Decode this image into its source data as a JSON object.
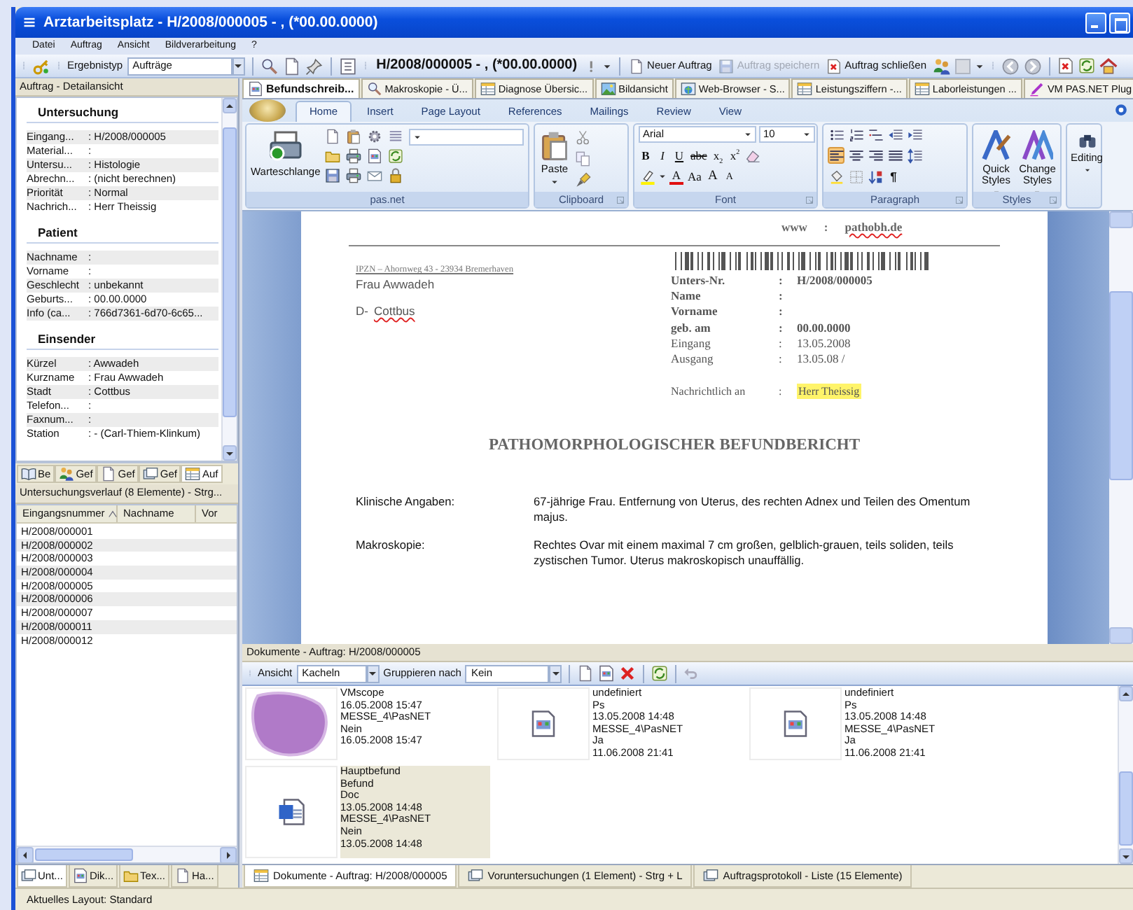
{
  "window": {
    "title": "Arztarbeitsplatz - H/2008/000005 - , (*00.00.0000)"
  },
  "menu": [
    "Datei",
    "Auftrag",
    "Ansicht",
    "Bildverarbeitung",
    "?"
  ],
  "toolbar": {
    "result_type_label": "Ergebnistyp",
    "result_type_value": "Aufträge",
    "case_title": "H/2008/000005 - , (*00.00.0000)",
    "buttons": [
      {
        "label": "Neuer Auftrag",
        "disabled": false
      },
      {
        "label": "Auftrag speichern",
        "disabled": true
      },
      {
        "label": "Auftrag schließen",
        "disabled": false
      }
    ]
  },
  "detail_panel": {
    "title": "Auftrag - Detailansicht",
    "sections": [
      {
        "title": "Untersuchung",
        "fields": [
          {
            "label": "Eingang...",
            "value": ": H/2008/000005"
          },
          {
            "label": "Material...",
            "value": ":"
          },
          {
            "label": "Untersu...",
            "value": ": Histologie"
          },
          {
            "label": "Abrechn...",
            "value": ": (nicht berechnen)"
          },
          {
            "label": "Priorität",
            "value": ": Normal"
          },
          {
            "label": "Nachrich...",
            "value": ": Herr Theissig"
          }
        ]
      },
      {
        "title": "Patient",
        "fields": [
          {
            "label": "Nachname",
            "value": ":"
          },
          {
            "label": "Vorname",
            "value": ":"
          },
          {
            "label": "Geschlecht",
            "value": ": unbekannt"
          },
          {
            "label": "Geburts...",
            "value": ": 00.00.0000"
          },
          {
            "label": "Info (ca...",
            "value": ": 766d7361-6d70-6c65..."
          }
        ]
      },
      {
        "title": "Einsender",
        "fields": [
          {
            "label": "Kürzel",
            "value": ": Awwadeh"
          },
          {
            "label": "Kurzname",
            "value": ": Frau Awwadeh"
          },
          {
            "label": "Stadt",
            "value": ": Cottbus"
          },
          {
            "label": "Telefon...",
            "value": ":"
          },
          {
            "label": "Faxnum...",
            "value": ":"
          },
          {
            "label": "Station",
            "value": ": - (Carl-Thiem-Klinkum)"
          }
        ]
      }
    ],
    "nav_tabs": [
      {
        "label": "Be",
        "selected": false
      },
      {
        "label": "Gef",
        "selected": false
      },
      {
        "label": "Gef",
        "selected": false
      },
      {
        "label": "Gef",
        "selected": false
      },
      {
        "label": "Auf",
        "selected": true
      }
    ]
  },
  "history": {
    "title": "Untersuchungsverlauf (8 Elemente) - Strg...",
    "columns": [
      {
        "label": "Eingangsnummer",
        "sorted": true
      },
      {
        "label": "Nachname",
        "sorted": false
      },
      {
        "label": "Vor",
        "sorted": false
      }
    ],
    "rows": [
      "H/2008/000001",
      "H/2008/000002",
      "H/2008/000003",
      "H/2008/000004",
      "H/2008/000005",
      "H/2008/000006",
      "H/2008/000007",
      "H/2008/000011",
      "H/2008/000012"
    ]
  },
  "left_tabs": [
    {
      "label": "Unt...",
      "selected": true
    },
    {
      "label": "Dik...",
      "selected": false
    },
    {
      "label": "Tex...",
      "selected": false
    },
    {
      "label": "Ha...",
      "selected": false
    }
  ],
  "doc_tabs": [
    {
      "label": "Befundschreib...",
      "selected": true
    },
    {
      "label": "Makroskopie - Ü...",
      "selected": false
    },
    {
      "label": "Diagnose Übersic...",
      "selected": false
    },
    {
      "label": "Bildansicht",
      "selected": false
    },
    {
      "label": "Web-Browser - S...",
      "selected": false
    },
    {
      "label": "Leistungsziffern -...",
      "selected": false
    },
    {
      "label": "Laborleistungen ...",
      "selected": false
    },
    {
      "label": "VM PAS.NET Plug",
      "selected": false
    }
  ],
  "ribbon": {
    "tabs": [
      {
        "label": "Home",
        "selected": true
      },
      {
        "label": "Insert",
        "selected": false
      },
      {
        "label": "Page Layout",
        "selected": false
      },
      {
        "label": "References",
        "selected": false
      },
      {
        "label": "Mailings",
        "selected": false
      },
      {
        "label": "Review",
        "selected": false
      },
      {
        "label": "View",
        "selected": false
      }
    ],
    "groups": [
      {
        "kind": "pasnet",
        "label": "pas.net",
        "button": "Warteschlange"
      },
      {
        "kind": "clipboard",
        "label": "Clipboard",
        "button": "Paste"
      },
      {
        "kind": "font",
        "label": "Font",
        "font": "Arial",
        "size": "10",
        "buttons": [
          {
            "label": "B",
            "kind": "bold"
          },
          {
            "label": "I",
            "kind": "italic"
          },
          {
            "label": "U",
            "kind": "underline"
          },
          {
            "label": "abc",
            "kind": "strike"
          },
          {
            "label": "x$_{2}$",
            "kind": "plain"
          },
          {
            "label": "x$^{2}$",
            "kind": "plain"
          }
        ],
        "buttons2": [
          {
            "label": "A",
            "kind": "color"
          },
          {
            "label": "Aa",
            "kind": "plain"
          },
          {
            "label": "A",
            "kind": "grow"
          },
          {
            "label": "A",
            "kind": "shrink"
          }
        ]
      },
      {
        "kind": "paragraph",
        "label": "Paragraph",
        "align_buttons": [
          {
            "kind": "left",
            "selected": true
          },
          {
            "kind": "center",
            "selected": false
          },
          {
            "kind": "right",
            "selected": false
          },
          {
            "kind": "justify",
            "selected": false
          }
        ],
        "marks_button": "¶"
      },
      {
        "kind": "styles",
        "label": "Styles",
        "buttons": [
          "Quick Styles",
          "Change Styles"
        ]
      },
      {
        "kind": "editing",
        "button": "Editing"
      }
    ]
  },
  "document": {
    "website": {
      "label": "www",
      "sep": ":",
      "value": "pathobh.de",
      "misspelled": true
    },
    "sender": "IPZN – Ahornweg 43 - 23934 Bremerhaven",
    "recipient": "Frau Awwadeh",
    "country": "D-",
    "city": {
      "text": "Cottbus",
      "misspelled": true
    },
    "info": [
      {
        "label": "Unters-Nr.",
        "sep": ":",
        "value": "H/2008/000005",
        "bold": true
      },
      {
        "label": "Name",
        "sep": ":",
        "bold": true
      },
      {
        "label": "Vorname",
        "sep": ":",
        "bold": true
      },
      {
        "label": "geb. am",
        "sep": ":",
        "value": "00.00.0000",
        "bold": true
      },
      {
        "label": "Eingang",
        "sep": ":",
        "value": "13.05.2008",
        "bold": false
      },
      {
        "label": "Ausgang",
        "sep": ":",
        "value": "13.05.08  /",
        "bold": false
      }
    ],
    "cc": {
      "label": "Nachrichtlich an",
      "sep": ":",
      "value": "Herr Theissig",
      "highlighted": true
    },
    "title": "PATHOMORPHOLOGISCHER BEFUNDBERICHT",
    "sections": [
      {
        "label": "Klinische Angaben:",
        "text": "67-jährige Frau. Entfernung von Uterus, des rechten Adnex und Teilen des Omentum majus."
      },
      {
        "label": "Makroskopie:",
        "text": "Rechtes Ovar mit einem maximal 7 cm großen, gelblich-grauen, teils soliden, teils zystischen Tumor. Uterus makroskopisch unauffällig."
      }
    ]
  },
  "documents_panel": {
    "title": "Dokumente - Auftrag: H/2008/000005",
    "view_label": "Ansicht",
    "view_value": "Kacheln",
    "group_label": "Gruppieren nach",
    "group_value": "Kein",
    "tiles": [
      {
        "kind": "slide",
        "selected": false,
        "lines": [
          "VMscope",
          "16.05.2008 15:47",
          "MESSE_4\\PasNET",
          "Nein",
          "16.05.2008 15:47"
        ]
      },
      {
        "kind": "file",
        "selected": false,
        "lines": [
          "undefiniert",
          "Ps",
          "13.05.2008 14:48",
          "MESSE_4\\PasNET",
          "Ja",
          "11.06.2008 21:41"
        ]
      },
      {
        "kind": "file",
        "selected": false,
        "lines": [
          "undefiniert",
          "Ps",
          "13.05.2008 14:48",
          "MESSE_4\\PasNET",
          "Ja",
          "11.06.2008 21:41"
        ]
      },
      {
        "kind": "word",
        "selected": true,
        "lines": [
          "Hauptbefund",
          "Befund",
          "Doc",
          "13.05.2008 14:48",
          "MESSE_4\\PasNET",
          "Nein",
          "13.05.2008 14:48"
        ]
      }
    ]
  },
  "bottom_tabs": [
    {
      "label": "Dokumente - Auftrag: H/2008/000005",
      "selected": true
    },
    {
      "label": "Voruntersuchungen (1 Element) - Strg + L",
      "selected": false
    },
    {
      "label": "Auftragsprotokoll - Liste (15 Elemente)",
      "selected": false
    }
  ],
  "status_bar": "Aktuelles Layout: Standard"
}
